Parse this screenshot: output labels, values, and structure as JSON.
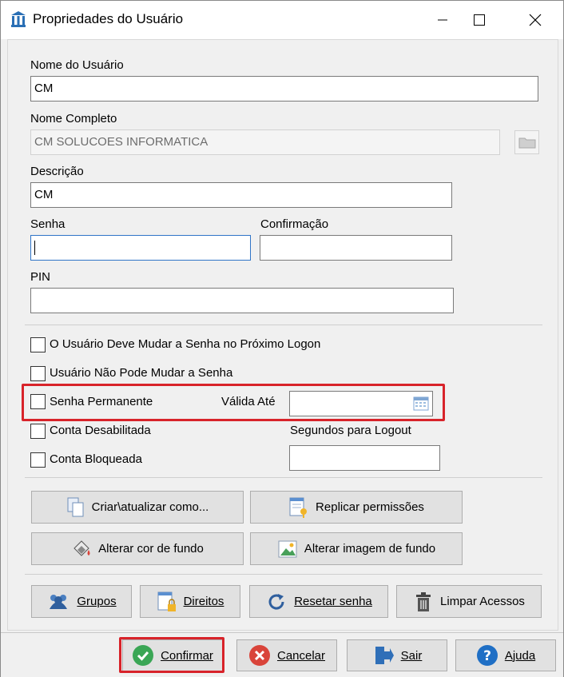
{
  "window": {
    "title": "Propriedades do Usuário",
    "app_icon": "app-icon",
    "minimize": "—",
    "maximize": "☐",
    "close": "✕"
  },
  "fields": {
    "username_label": "Nome do Usuário",
    "username_value": "CM",
    "fullname_label": "Nome Completo",
    "fullname_value": "CM SOLUCOES INFORMATICA",
    "description_label": "Descrição",
    "description_value": "CM",
    "password_label": "Senha",
    "password_value": "",
    "confirm_label": "Confirmação",
    "confirm_value": "",
    "pin_label": "PIN",
    "pin_value": ""
  },
  "options": {
    "must_change": "O Usuário Deve Mudar a Senha no Próximo Logon",
    "cannot_change": "Usuário Não Pode Mudar a Senha",
    "permanent": "Senha Permanente",
    "valid_until_label": "Válida Até",
    "valid_until_value": "",
    "disabled": "Conta Desabilitada",
    "logout_label": "Segundos para Logout",
    "logout_value": "",
    "locked": "Conta Bloqueada"
  },
  "actions": {
    "create_update": "Criar\\atualizar como...",
    "replicate": "Replicar permissões",
    "bg_color": "Alterar cor de fundo",
    "bg_image": "Alterar imagem de fundo",
    "groups": "Grupos",
    "rights": "Direitos",
    "reset_password": "Resetar senha",
    "clear_access": "Limpar Acessos"
  },
  "footer": {
    "confirm": "Confirmar",
    "cancel": "Cancelar",
    "exit": "Sair",
    "help": "Ajuda"
  },
  "colors": {
    "highlight": "#d8232a",
    "focus": "#2f74c7",
    "confirm_green": "#3aa655",
    "cancel_red": "#d9443a",
    "help_blue": "#1f6fc5"
  }
}
